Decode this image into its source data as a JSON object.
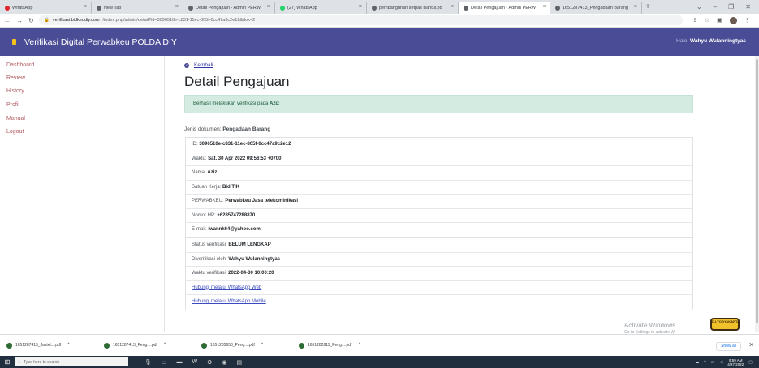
{
  "browser": {
    "tabs": [
      {
        "title": "WhatsApp",
        "color": "#e3242b"
      },
      {
        "title": "New Tab",
        "color": "#5f6368"
      },
      {
        "title": "Detail Pengajuan - Admin PERW",
        "color": "#5f6368"
      },
      {
        "title": "(27) WhatsApp",
        "color": "#25d366"
      },
      {
        "title": "pembangunan setpas Bantul.pd",
        "color": "#5f6368"
      },
      {
        "title": "Detail Pengajuan - Admin PERW",
        "color": "#5f6368"
      },
      {
        "title": "1651287413_Pengadaan Barang",
        "color": "#5f6368"
      }
    ],
    "url_domain": "verifikasi.bidkeudiy.com",
    "url_path": "/index.php/admin/detail?id=3096510e-c831-11ec-805f-0cc47a9c2e12&dok=2"
  },
  "app": {
    "title": "Verifikasi Digital Perwabkeu POLDA DIY",
    "greeting_prefix": "Halo, ",
    "user_name": "Wahyu Wulanningtyas"
  },
  "sidebar": {
    "items": [
      "Dashboard",
      "Review",
      "History",
      "Profil",
      "Manual",
      "Logout"
    ]
  },
  "main": {
    "back_label": "Kembali",
    "page_title": "Detail Pengajuan",
    "alert_prefix": "Berhasil melakukan verifikasi pada ",
    "alert_name": "Aziz",
    "doc_label": "Jenis dokumen: ",
    "doc_value": "Pengadaan Barang",
    "details": [
      {
        "label": "ID: ",
        "value": "3096510e-c831-11ec-805f-0cc47a9c2e12"
      },
      {
        "label": "Waktu: ",
        "value": "Sat, 30 Apr 2022 09:56:53 +0700"
      },
      {
        "label": "Nama: ",
        "value": "Aziz"
      },
      {
        "label": "Satuan Kerja: ",
        "value": "Bid TIK"
      },
      {
        "label": "PERWABKEU: ",
        "value": "Perwabkeu Jasa telekominikasi"
      },
      {
        "label": "Nomor HP: ",
        "value": "+6285747288870"
      },
      {
        "label": "E-mail: ",
        "value": "iwannk64@yahoo.com"
      }
    ],
    "verification": [
      {
        "label": "Status verifikasi: ",
        "value": "BELUM LENGKAP"
      },
      {
        "label": "Diverifikasi oleh: ",
        "value": "Wahyu Wulanningtyas"
      },
      {
        "label": "Waktu verifikasi: ",
        "value": "2022-04-30 10:00:20"
      }
    ],
    "links": [
      "Hubungi melalui WhatsApp Web",
      "Hubungi melalui WhatsApp Mobile"
    ]
  },
  "overlay": {
    "activate_title": "Activate Windows",
    "activate_sub": "Go to Settings to activate W",
    "badge": "D.I.YOGYAKARTA"
  },
  "downloads": {
    "items": [
      "1651287413_Jastel....pdf",
      "1651287413_Peng....pdf",
      "1651285658_Peng....pdf",
      "1651282811_Peng....pdf"
    ],
    "show_all": "Show all"
  },
  "taskbar": {
    "search_placeholder": "Type here to search",
    "time": "9:59 AM",
    "date": "4/27/2022"
  }
}
